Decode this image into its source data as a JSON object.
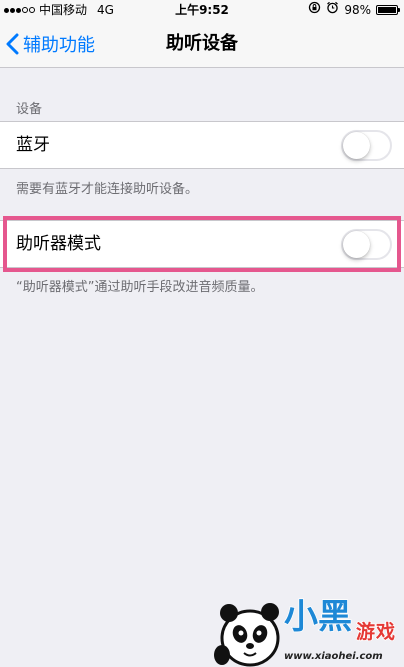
{
  "status_bar": {
    "carrier": "中国移动",
    "network": "4G",
    "time": "上午9:52",
    "battery": "98%",
    "battery_level": 0.98,
    "signal_bars_filled": 3,
    "signal_bars_total": 5
  },
  "nav": {
    "back_label": "辅助功能",
    "title": "助听设备"
  },
  "devices_section": {
    "header": "设备",
    "bluetooth_label": "蓝牙",
    "bluetooth_on": false,
    "footer": "需要有蓝牙才能连接助听设备。"
  },
  "hearing_aid_mode": {
    "label": "助听器模式",
    "on": false,
    "footer": "“助听器模式”通过助听手段改进音频质量。"
  },
  "watermark": {
    "brand_text": "小黑游戏",
    "url": "www.xiaohei.com"
  },
  "colors": {
    "accent": "#007aff",
    "background": "#efeff4",
    "highlight": "#e5578e",
    "watermark_blue": "#1e88d6",
    "watermark_red": "#e53935"
  },
  "icons": {
    "back": "chevron-left-icon",
    "rotation_lock": "rotation-lock-icon",
    "alarm": "alarm-icon",
    "battery": "battery-icon"
  }
}
